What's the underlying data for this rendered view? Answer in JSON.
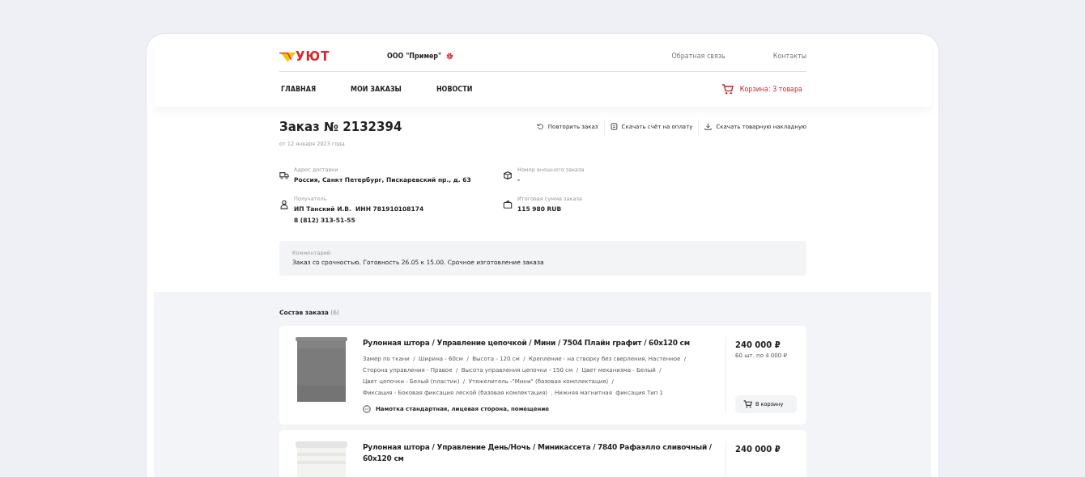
{
  "header": {
    "logo": "УЮТ",
    "company": "ООО \"Пример\"",
    "links": [
      "Обратная связь",
      "Контакты"
    ]
  },
  "nav": {
    "items": [
      "ГЛАВНАЯ",
      "МОИ ЗАКАЗЫ",
      "НОВОСТИ"
    ],
    "cart": "Корзина: 3 товара"
  },
  "order": {
    "title": "Заказ № 2132394",
    "date": "от 12 января 2023 года",
    "actions": [
      {
        "kind": "repeat",
        "label": "Повторить заказ"
      },
      {
        "kind": "invoice",
        "label": "Скачать счёт на оплату"
      },
      {
        "kind": "download",
        "label": "Скачать товарную накладную"
      }
    ],
    "info": [
      {
        "kind": "truck",
        "label": "Адрес доставки",
        "lines": [
          "Россия, Санкт Петербург, Пискаревский пр., д. 63"
        ]
      },
      {
        "kind": "box",
        "label": "Номер внешнего заказа",
        "lines": [
          "-"
        ]
      },
      {
        "kind": "person",
        "label": "Получатель",
        "lines": [
          "ИП Танский И.В.  ИНН 781910108174",
          "8 (812) 313-51-55"
        ]
      },
      {
        "kind": "wallet",
        "label": "Итоговая сумма заказа",
        "lines": [
          "115 980 RUB"
        ]
      }
    ],
    "comment": {
      "label": "Комментарий",
      "text": "Заказ со срочностью. Готовность 26.05 к 15.00. Срочное изготовление заказа"
    }
  },
  "items": {
    "title": "Состав заказа",
    "count": "(6)",
    "list": [
      {
        "title": "Рулонная штора / Управление цепочкой / Мини / 7504 Плайн графит / 60x120 см",
        "specs": [
          "Замер по ткани  /  Ширина - 60см  /  Высота - 120 см  /  Крепление - на створку без сверления, Настенное  /",
          "Сторона управления - Правое  /  Высота управления цепочки - 150 см  /  Цвет механизма - Белый  /",
          "Цвет цепочки - Белый (пластик)  /  Утяжелитель -\"Мини\" (базовая комплектация)  /",
          "Фиксация - Боковая фиксация леской (базовая комлектация)  , Нижняя магнитная  фиксация Тип 1"
        ],
        "note": "Намотка стандартная, лицевая сторона, помещение",
        "price": "240 000 ₽",
        "unit": "60 шт. по 4 000 ₽",
        "button": "В корзину"
      },
      {
        "title": "Рулонная штора / Управление День/Ночь / Миникассета / 7840 Рафаэлло сливочный / 60x120 см",
        "price": "240 000 ₽"
      }
    ]
  }
}
